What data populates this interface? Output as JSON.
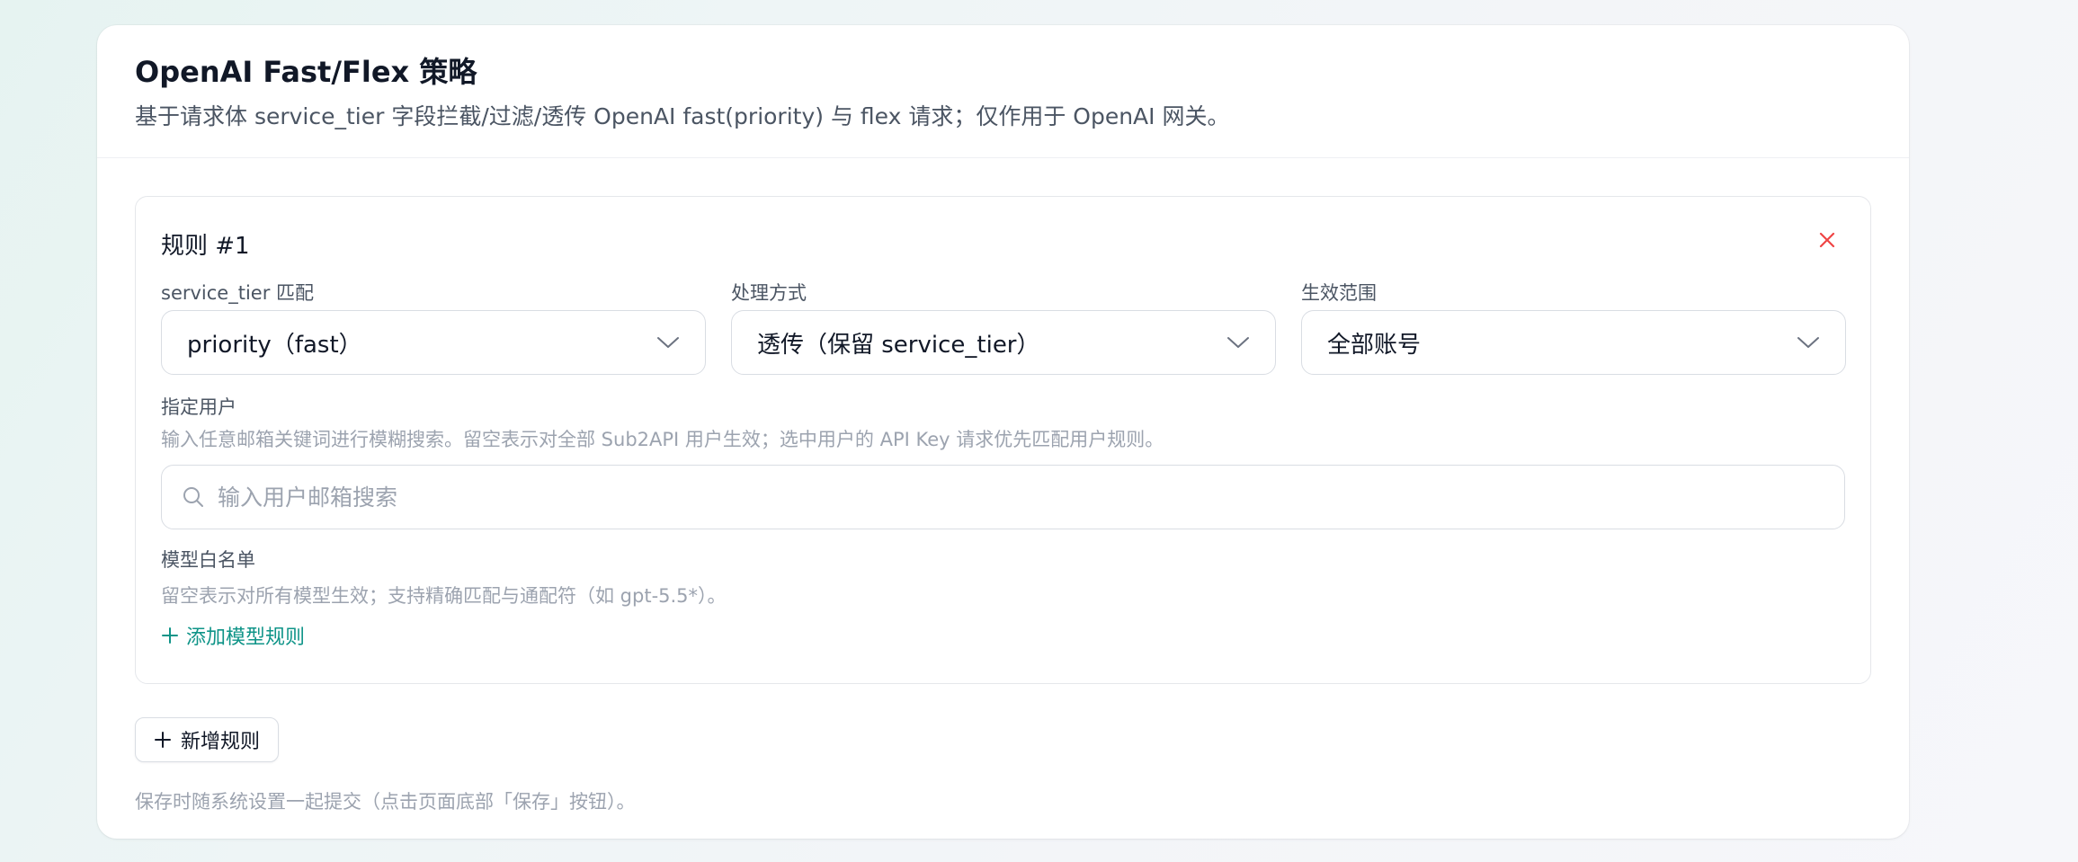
{
  "card": {
    "title": "OpenAI Fast/Flex 策略",
    "subtitle": "基于请求体 service_tier 字段拦截/过滤/透传 OpenAI fast(priority) 与 flex 请求；仅作用于 OpenAI 网关。"
  },
  "rule": {
    "title": "规则 #1",
    "close_icon": "close-icon",
    "tier_match": {
      "label": "service_tier 匹配",
      "value": "priority（fast）"
    },
    "action": {
      "label": "处理方式",
      "value": "透传（保留 service_tier）"
    },
    "scope": {
      "label": "生效范围",
      "value": "全部账号"
    },
    "users": {
      "label": "指定用户",
      "hint": "输入任意邮箱关键词进行模糊搜索。留空表示对全部 Sub2API 用户生效；选中用户的 API Key 请求优先匹配用户规则。",
      "placeholder": "输入用户邮箱搜索"
    },
    "models": {
      "label": "模型白名单",
      "hint": "留空表示对所有模型生效；支持精确匹配与通配符（如 gpt-5.5*）。",
      "add_label": "添加模型规则"
    }
  },
  "add_rule_label": "新增规则",
  "footer_note": "保存时随系统设置一起提交（点击页面底部「保存」按钮）。",
  "colors": {
    "accent": "#0f9488",
    "danger": "#ef4444",
    "muted": "#9ca3af"
  }
}
